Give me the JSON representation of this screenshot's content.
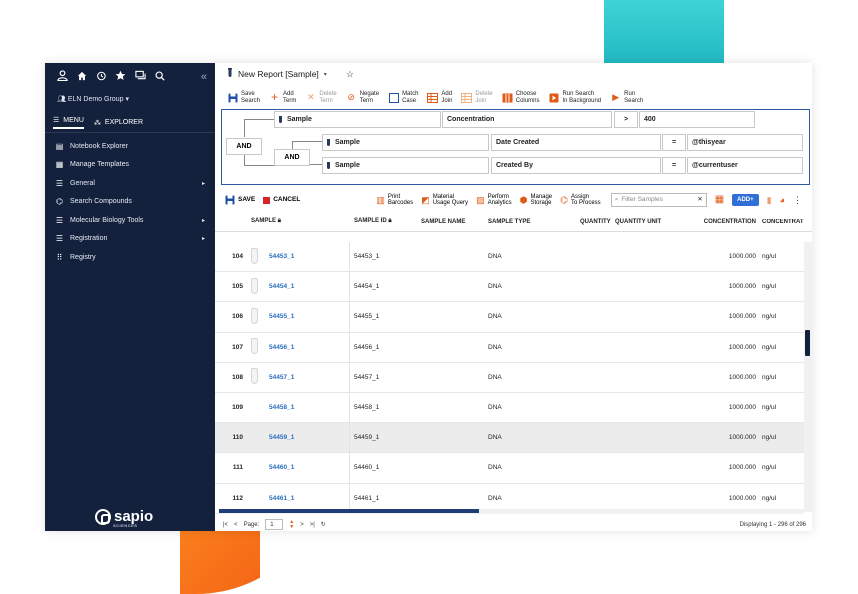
{
  "sidebar": {
    "group": "ELN Demo Group",
    "tabs": {
      "menu": "MENU",
      "explorer": "EXPLORER"
    },
    "items": [
      {
        "label": "Notebook Explorer",
        "icon": "notebook-icon",
        "arrow": ""
      },
      {
        "label": "Manage Templates",
        "icon": "template-icon",
        "arrow": ""
      },
      {
        "label": "General",
        "icon": "list-icon",
        "arrow": "▸"
      },
      {
        "label": "Search Compounds",
        "icon": "compound-icon",
        "arrow": ""
      },
      {
        "label": "Molecular Biology Tools",
        "icon": "list-icon",
        "arrow": "▸"
      },
      {
        "label": "Registration",
        "icon": "list-icon",
        "arrow": "▸"
      },
      {
        "label": "Registry",
        "icon": "grid-icon",
        "arrow": ""
      }
    ],
    "logo": "sapio",
    "logo_sub": "SCIENCES"
  },
  "titlebar": {
    "title": "New Report [Sample]"
  },
  "toolbar": {
    "save_search": [
      "Save",
      "Search"
    ],
    "add_term": [
      "Add",
      "Term"
    ],
    "delete_term": [
      "Delete",
      "Term"
    ],
    "negate_term": [
      "Negate",
      "Term"
    ],
    "match_case": [
      "Match",
      "Case"
    ],
    "add_join": [
      "Add",
      "Join"
    ],
    "delete_join": [
      "Delete",
      "Join"
    ],
    "choose_columns": [
      "Choose",
      "Columns"
    ],
    "run_background": [
      "Run Search",
      "In Background"
    ],
    "run_search": [
      "Run",
      "Search"
    ]
  },
  "query": {
    "and1": "AND",
    "and2": "AND",
    "term1": {
      "type": "Sample",
      "field": "Concentration",
      "op": ">",
      "value": "400"
    },
    "term2": {
      "type": "Sample",
      "field": "Date Created",
      "op": "=",
      "value": "@thisyear"
    },
    "term3": {
      "type": "Sample",
      "field": "Created By",
      "op": "=",
      "value": "@currentuser"
    }
  },
  "actions": {
    "save": "SAVE",
    "cancel": "CANCEL",
    "print": [
      "Print",
      "Barcodes"
    ],
    "material": [
      "Material",
      "Usage Query"
    ],
    "analytics": [
      "Perform",
      "Analytics"
    ],
    "storage": [
      "Manage",
      "Storage"
    ],
    "assign": [
      "Assign",
      "To Process"
    ],
    "filter_placeholder": "Filter Samples",
    "add": "ADD+"
  },
  "columns": {
    "sample": "SAMPLE",
    "sample_id": "SAMPLE ID",
    "sample_name": "SAMPLE NAME",
    "sample_type": "SAMPLE TYPE",
    "quantity": "QUANTITY",
    "quantity_unit": "QUANTITY UNIT",
    "concentration": "CONCENTRATION",
    "concentration_unit": "CONCENTRAT"
  },
  "rows": [
    {
      "n": "104",
      "sample": "54453_1",
      "id": "54453_1",
      "type": "DNA",
      "conc": "1000.000",
      "unit": "ng/ul"
    },
    {
      "n": "105",
      "sample": "54454_1",
      "id": "54454_1",
      "type": "DNA",
      "conc": "1000.000",
      "unit": "ng/ul"
    },
    {
      "n": "106",
      "sample": "54455_1",
      "id": "54455_1",
      "type": "DNA",
      "conc": "1000.000",
      "unit": "ng/ul"
    },
    {
      "n": "107",
      "sample": "54456_1",
      "id": "54456_1",
      "type": "DNA",
      "conc": "1000.000",
      "unit": "ng/ul"
    },
    {
      "n": "108",
      "sample": "54457_1",
      "id": "54457_1",
      "type": "DNA",
      "conc": "1000.000",
      "unit": "ng/ul"
    },
    {
      "n": "109",
      "sample": "54458_1",
      "id": "54458_1",
      "type": "DNA",
      "conc": "1000.000",
      "unit": "ng/ul"
    },
    {
      "n": "110",
      "sample": "54459_1",
      "id": "54459_1",
      "type": "DNA",
      "conc": "1000.000",
      "unit": "ng/ul"
    },
    {
      "n": "111",
      "sample": "54460_1",
      "id": "54460_1",
      "type": "DNA",
      "conc": "1000.000",
      "unit": "ng/ul"
    },
    {
      "n": "112",
      "sample": "54461_1",
      "id": "54461_1",
      "type": "DNA",
      "conc": "1000.000",
      "unit": "ng/ul"
    }
  ],
  "pager": {
    "page_label": "Page:",
    "page": "1",
    "display": "Displaying 1 - 296 of 296"
  },
  "colors": {
    "sidebar_bg": "#14213d",
    "accent_blue": "#2f6fd6",
    "link": "#2a6ebd",
    "orange": "#f05a14",
    "teal": "#21b9c2"
  }
}
